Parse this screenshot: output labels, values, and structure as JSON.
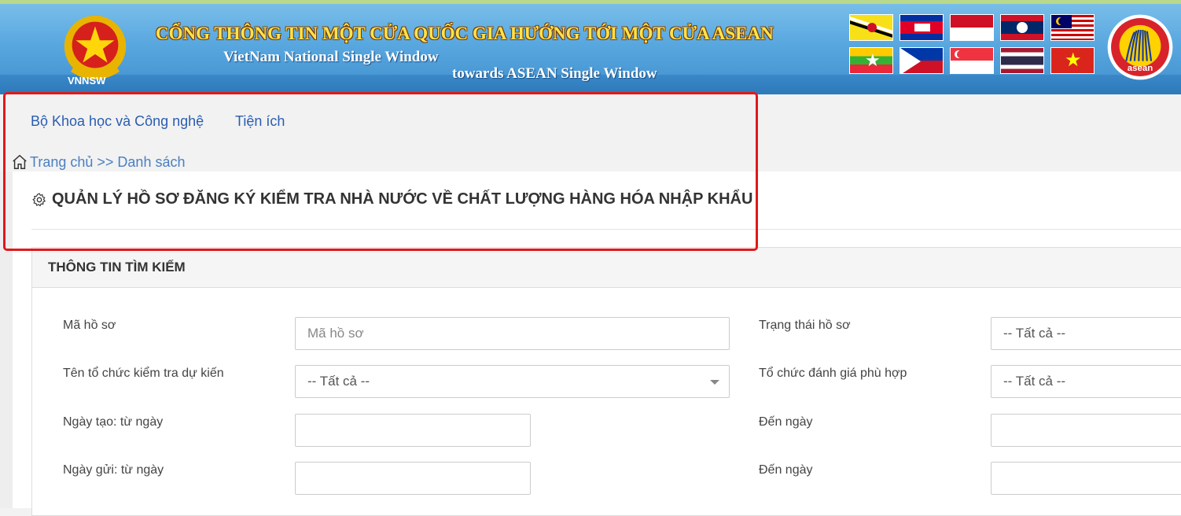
{
  "banner": {
    "vnnsw_label": "VNNSW",
    "title": "CỔNG THÔNG TIN MỘT CỬA QUỐC GIA HƯỚNG TỚI MỘT CỬA ASEAN",
    "subtitle_line1": "VietNam National Single Window",
    "subtitle_line2": "towards ASEAN Single Window",
    "emblem_icon": "vietnam-national-emblem",
    "logo_icon": "asean-logo",
    "asean_logo_text": "asean",
    "flags": [
      "brunei",
      "cambodia",
      "indonesia",
      "laos",
      "malaysia",
      "myanmar",
      "philippines",
      "singapore",
      "thailand",
      "vietnam"
    ]
  },
  "nav": {
    "items": [
      {
        "label": "Bộ Khoa học và Công nghệ"
      },
      {
        "label": "Tiện ích"
      }
    ]
  },
  "breadcrumb": {
    "home": "Trang chủ",
    "separator": ">>",
    "current": "Danh sách"
  },
  "page": {
    "title": "QUẢN LÝ HỒ SƠ ĐĂNG KÝ KIỂM TRA NHÀ NƯỚC VỀ CHẤT LƯỢNG HÀNG HÓA NHẬP KHẨU"
  },
  "search": {
    "heading": "THÔNG TIN TÌM KIẾM",
    "ma_ho_so": {
      "label": "Mã hồ sơ",
      "placeholder": "Mã hồ sơ",
      "value": ""
    },
    "trang_thai": {
      "label": "Trạng thái hồ sơ",
      "value": "-- Tất cả --"
    },
    "to_chuc_kiem_tra": {
      "label": "Tên tổ chức kiểm tra dự kiến",
      "value": "-- Tất cả --"
    },
    "to_chuc_danh_gia": {
      "label": "Tổ chức đánh giá phù hợp",
      "value": "-- Tất cả --"
    },
    "ngay_tao_tu": {
      "label": "Ngày tạo: từ ngày",
      "value": ""
    },
    "ngay_tao_den": {
      "label": "Đến ngày",
      "value": ""
    },
    "ngay_gui_tu": {
      "label": "Ngày gửi: từ ngày",
      "value": ""
    },
    "ngay_gui_den": {
      "label": "Đến ngày",
      "value": ""
    }
  },
  "colors": {
    "link": "#2a5db0",
    "highlight_border": "#e0191b",
    "banner_title": "#ffe34d"
  }
}
